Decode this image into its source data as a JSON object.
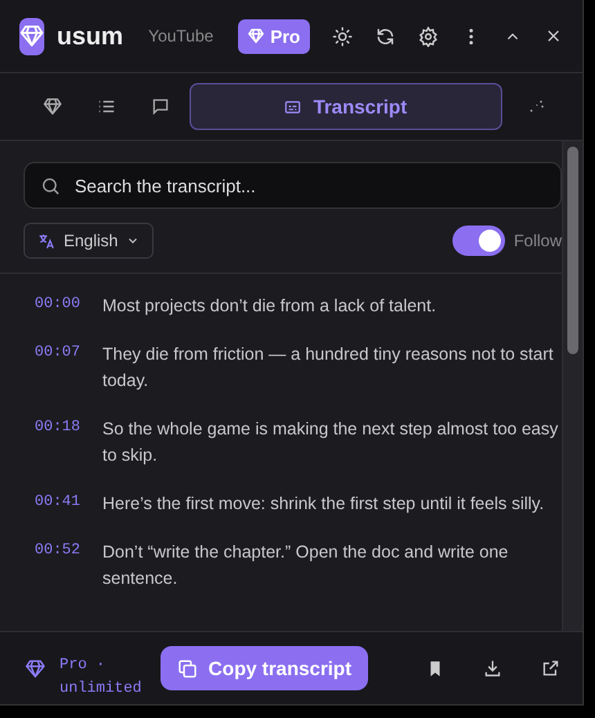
{
  "header": {
    "title": "usum",
    "source": "YouTube",
    "plan_badge": "Pro"
  },
  "tabs": [
    {
      "kind": "summary",
      "selected": false
    },
    {
      "kind": "outline",
      "selected": false
    },
    {
      "kind": "chat",
      "selected": false
    },
    {
      "kind": "transcript",
      "label": "Transcript",
      "selected": true
    },
    {
      "kind": "sparkle",
      "selected": false
    }
  ],
  "search": {
    "placeholder": "Search the transcript..."
  },
  "language": {
    "label": "English"
  },
  "follow": {
    "label": "Follow",
    "on": true
  },
  "lines": [
    {
      "time": "00:00",
      "text": "Most projects don’t die from a lack of talent."
    },
    {
      "time": "00:07",
      "text": "They die from friction — a hundred tiny reasons not to start today."
    },
    {
      "time": "00:18",
      "text": "So the whole game is making the next step almost too easy to skip."
    },
    {
      "time": "00:41",
      "text": "Here’s the first move: shrink the first step until it feels silly."
    },
    {
      "time": "00:52",
      "text": "Don’t “write the chapter.” Open the doc and write one sentence."
    }
  ],
  "footer": {
    "plan": "Pro ·",
    "plan_detail": "unlimited",
    "copy_button": "Copy transcript"
  }
}
